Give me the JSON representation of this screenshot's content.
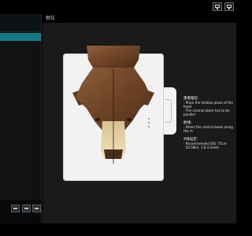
{
  "main": {
    "title": "侧位"
  },
  "info": {
    "heading_notes": "患者摆位:",
    "note_1": "- Place the median plane of the head",
    "note_2": "- The coronal plane has to be parallel",
    "heading_beam": "射线:",
    "beam_1": "- Direct the central beam along the m",
    "heading_settings": "X线设定:",
    "setting_1": "- Recommended SID: 75cm",
    "setting_2": "- 50-58kV, 1.6-3.2mAs"
  },
  "icons": {
    "top_1": "monitor-icon",
    "top_2": "display-icon",
    "footer_1": "list-icon",
    "footer_2": "grid-icon",
    "footer_3": "menu-icon"
  }
}
